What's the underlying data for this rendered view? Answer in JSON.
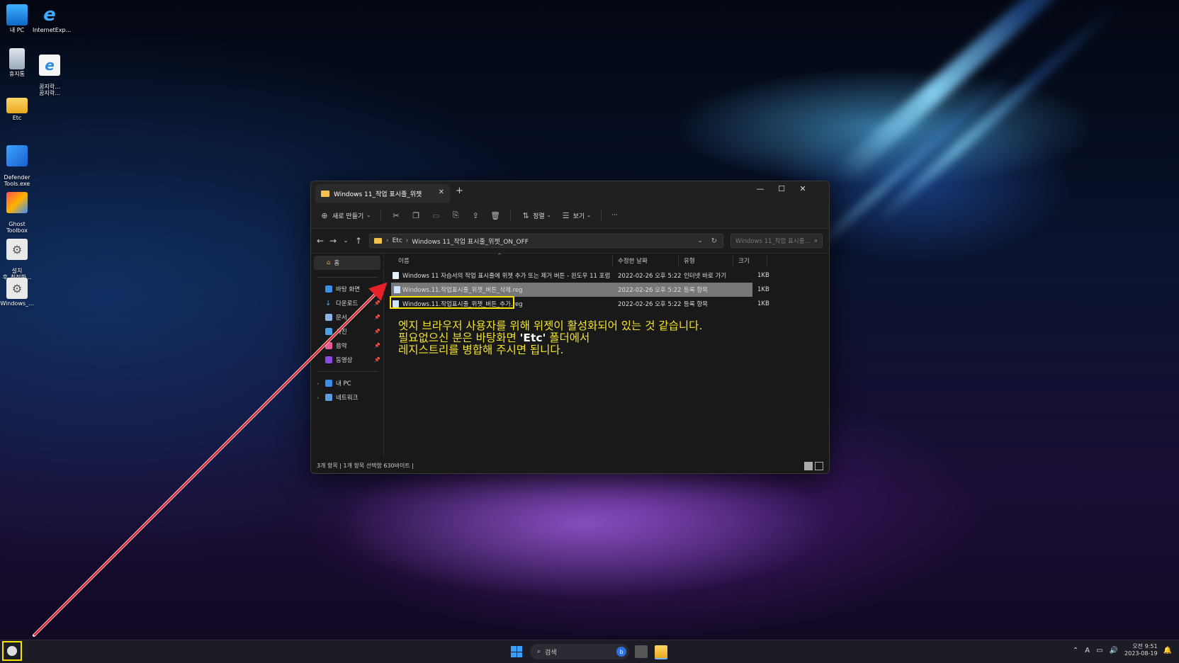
{
  "desktop": {
    "icons": [
      {
        "label": "내 PC"
      },
      {
        "label": "InternetExp..."
      },
      {
        "label": "휴지통"
      },
      {
        "label": "꿈지락...\n꿈지락..."
      },
      {
        "label": "Etc"
      },
      {
        "label": "Defender\nTools.exe"
      },
      {
        "label": "Ghost\nToolbox"
      },
      {
        "label": "설치\n후_최적화..."
      },
      {
        "label": "Windows_..."
      }
    ]
  },
  "explorer": {
    "tab_title": "Windows 11_작업 표시줄_위젯",
    "toolbar": {
      "new_label": "새로 만들기",
      "sort_label": "정렬",
      "view_label": "보기",
      "more_label": "···"
    },
    "address": {
      "crumb1": "Etc",
      "crumb2": "Windows 11_작업 표시줄_위젯_ON_OFF",
      "search_placeholder": "Windows 11_작업 표시줄..."
    },
    "sidebar": {
      "home": "홈",
      "items": [
        {
          "label": "바탕 화면"
        },
        {
          "label": "다운로드"
        },
        {
          "label": "문서"
        },
        {
          "label": "사진"
        },
        {
          "label": "음악"
        },
        {
          "label": "동영상"
        }
      ],
      "this_pc": "내 PC",
      "network": "네트워크"
    },
    "columns": {
      "name": "이름",
      "date": "수정한 날짜",
      "type": "유형",
      "size": "크기"
    },
    "files": [
      {
        "name": "Windows 11 자습서의 작업 표시줄에 위젯 추가 또는 제거 버튼 - 윈도우 11 포럼",
        "date": "2022-02-26 오후 5:22",
        "type": "인터넷 바로 가기",
        "size": "1KB"
      },
      {
        "name": "Windows.11.작업표시줄_위젯_버튼_삭제.reg",
        "date": "2022-02-26 오후 5:22",
        "type": "등록 항목",
        "size": "1KB"
      },
      {
        "name": "Windows.11.작업표시줄_위젯_버튼_추가.reg",
        "date": "2022-02-26 오후 5:22",
        "type": "등록 항목",
        "size": "1KB"
      }
    ],
    "note": {
      "line1": "엣지 브라우저 사용자를 위해 위젯이 활성화되어 있는 것 같습니다.",
      "line2_a": "필요없으신 분은 바탕화면 ",
      "line2_b": "'Etc'",
      "line2_c": " 폴더에서",
      "line3": "레지스트리를 병합해 주시면 됩니다."
    },
    "status": "3개 항목  |  1개 항목 선택함 630바이트  |"
  },
  "taskbar": {
    "search_label": "검색",
    "time": "오전 9:51",
    "date": "2023-08-19"
  },
  "colors": {
    "highlight": "#f5e400",
    "note_text": "#f4e32a",
    "arrow": "#e8202a"
  }
}
